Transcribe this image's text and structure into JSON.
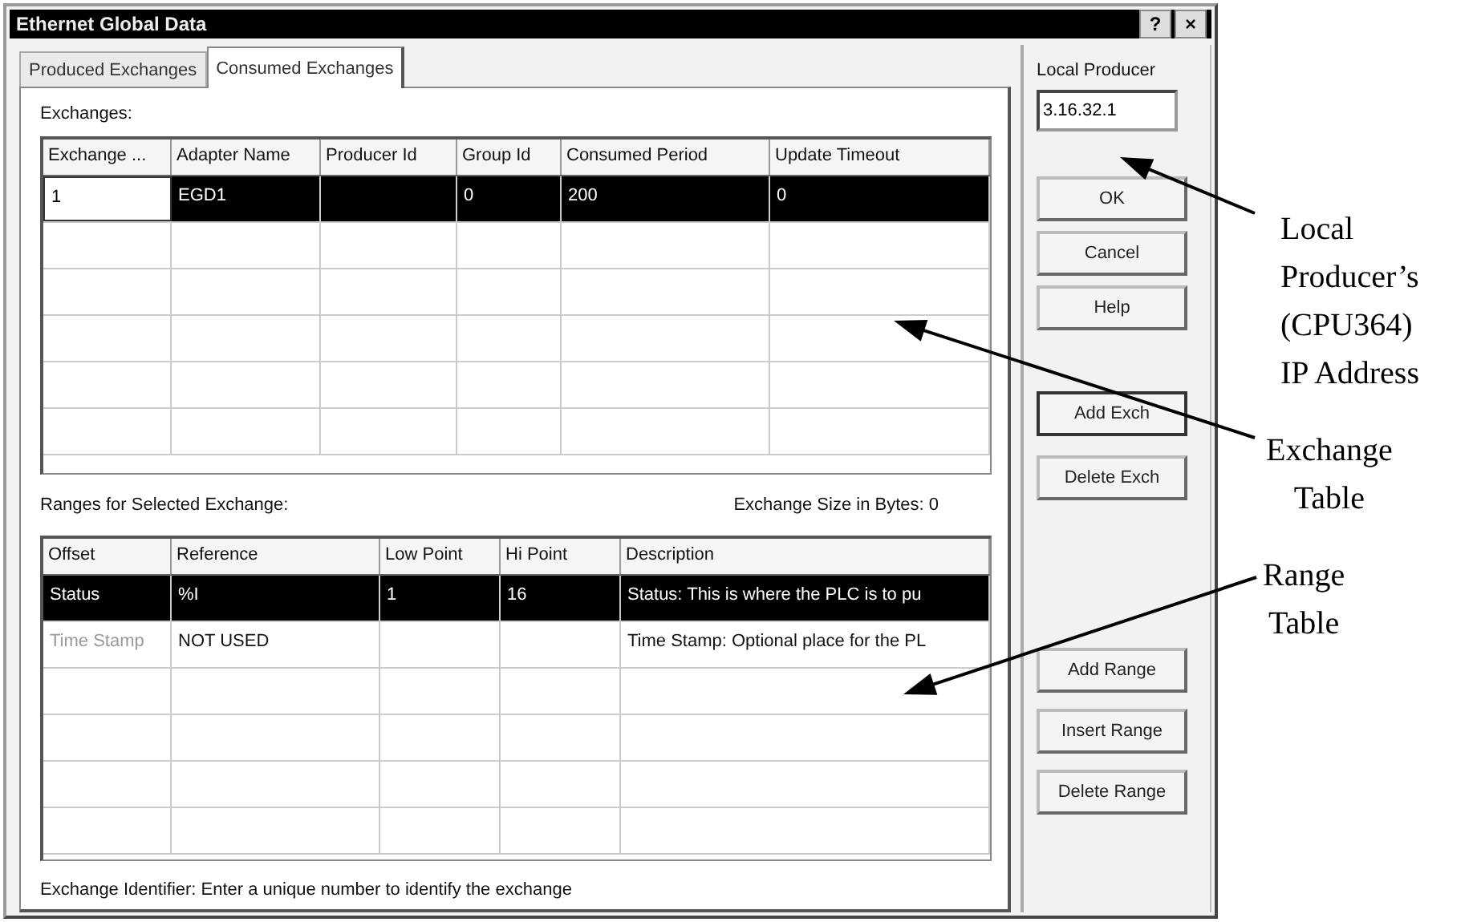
{
  "window": {
    "title": "Ethernet Global Data",
    "title_buttons": [
      "?",
      "×"
    ]
  },
  "tabs": [
    {
      "label": "Produced Exchanges",
      "selected": false
    },
    {
      "label": "Consumed Exchanges",
      "selected": true
    }
  ],
  "exchanges": {
    "label": "Exchanges:",
    "columns": [
      "Exchange ...",
      "Adapter Name",
      "Producer Id",
      "Group Id",
      "Consumed Period",
      "Update Timeout"
    ],
    "rows": [
      {
        "selected": true,
        "editing_first_cell": true,
        "cells": [
          "1",
          "EGD1",
          null,
          "0",
          "200",
          "0"
        ]
      }
    ]
  },
  "ranges": {
    "label": "Ranges for Selected Exchange:",
    "size_label": "Exchange Size in Bytes: 0",
    "columns": [
      "Offset",
      "Reference",
      "Low Point",
      "Hi Point",
      "Description"
    ],
    "rows": [
      {
        "selected": true,
        "offset_disabled": false,
        "cells": [
          "Status",
          "%I",
          "1",
          "16",
          "Status: This is where the PLC is to pu"
        ]
      },
      {
        "selected": false,
        "offset_disabled": true,
        "cells": [
          "Time Stamp",
          "NOT USED",
          null,
          null,
          "Time Stamp: Optional place for the PL"
        ]
      }
    ]
  },
  "status_text": "Exchange Identifier: Enter a unique number to identify the exchange",
  "local_producer": {
    "label": "Local Producer",
    "value": "3.16.32.1"
  },
  "button_groups": [
    [
      {
        "label": "OK",
        "default": false
      },
      {
        "label": "Cancel",
        "default": false
      },
      {
        "label": "Help",
        "default": false
      }
    ],
    [
      {
        "label": "Add Exch",
        "default": true
      },
      {
        "label": "Delete Exch",
        "default": false
      }
    ],
    [
      {
        "label": "Add Range",
        "default": false
      },
      {
        "label": "Insert Range",
        "default": false
      },
      {
        "label": "Delete Range",
        "default": false
      }
    ]
  ],
  "annotations": [
    {
      "lines": [
        "Local",
        "Producer’s",
        "(CPU364)",
        "IP Address"
      ]
    },
    {
      "lines": [
        "Exchange",
        "Table"
      ]
    },
    {
      "lines": [
        "Range",
        "Table"
      ]
    }
  ]
}
